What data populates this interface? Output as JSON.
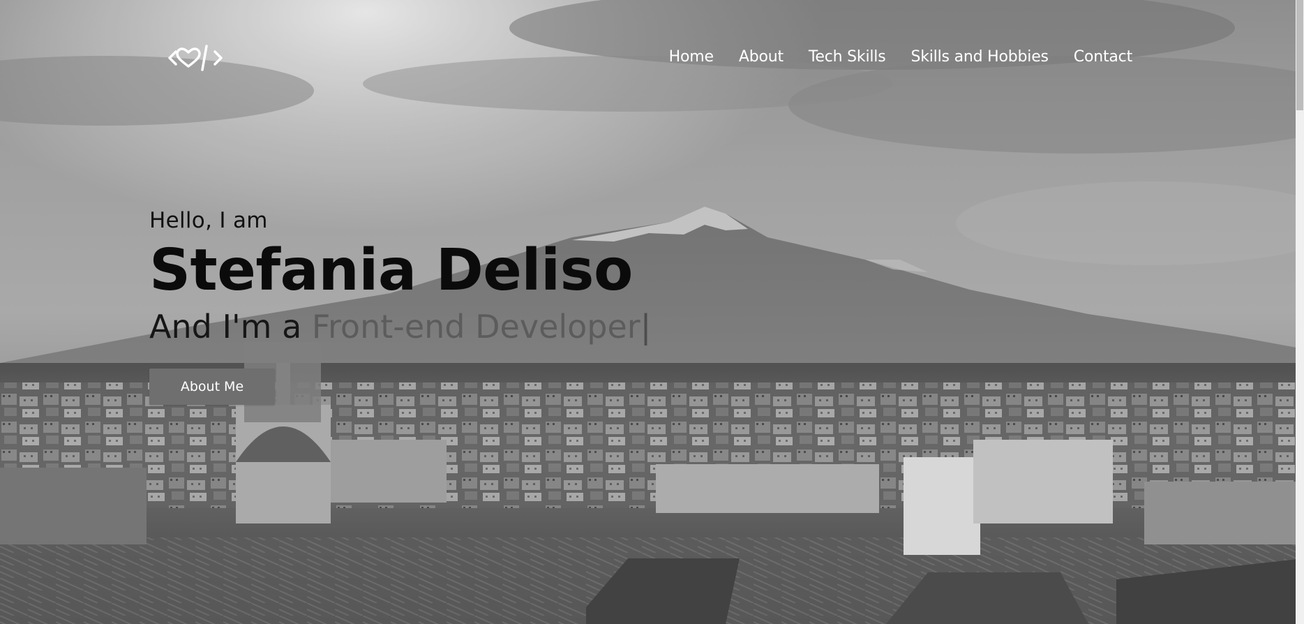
{
  "nav": {
    "items": [
      {
        "label": "Home"
      },
      {
        "label": "About"
      },
      {
        "label": "Tech Skills"
      },
      {
        "label": "Skills and Hobbies"
      },
      {
        "label": "Contact"
      }
    ]
  },
  "logo": {
    "icon": "code-heart-icon"
  },
  "hero": {
    "greeting": "Hello, I am",
    "name": "Stefania Deliso",
    "role_prefix": "And I'm a ",
    "role_typed": "Front-end Developer",
    "cursor": "|",
    "button_label": "About Me"
  },
  "colors": {
    "button_bg": "#6f6f6f",
    "nav_text": "#ffffff",
    "heading_text": "#0b0b0b",
    "typed_text": "#5c5c5c"
  }
}
